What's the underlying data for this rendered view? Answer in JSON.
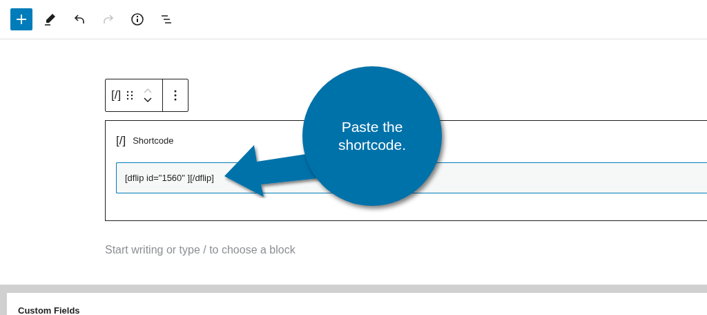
{
  "toolbar": [
    {
      "kind": "add",
      "disabled": false
    },
    {
      "kind": "tools",
      "disabled": false
    },
    {
      "kind": "undo",
      "disabled": false
    },
    {
      "kind": "redo",
      "disabled": true
    },
    {
      "kind": "info",
      "disabled": false
    },
    {
      "kind": "outline",
      "disabled": false
    }
  ],
  "block_toolbar": {
    "block_icon": "[/]"
  },
  "block": {
    "icon": "[/]",
    "title": "Shortcode",
    "value": "[dflip id=\"1560\" ][/dflip]"
  },
  "appender": {
    "placeholder": "Start writing or type / to choose a block"
  },
  "callout": {
    "text": "Paste the shortcode."
  },
  "metabox": {
    "title": "Custom Fields"
  }
}
